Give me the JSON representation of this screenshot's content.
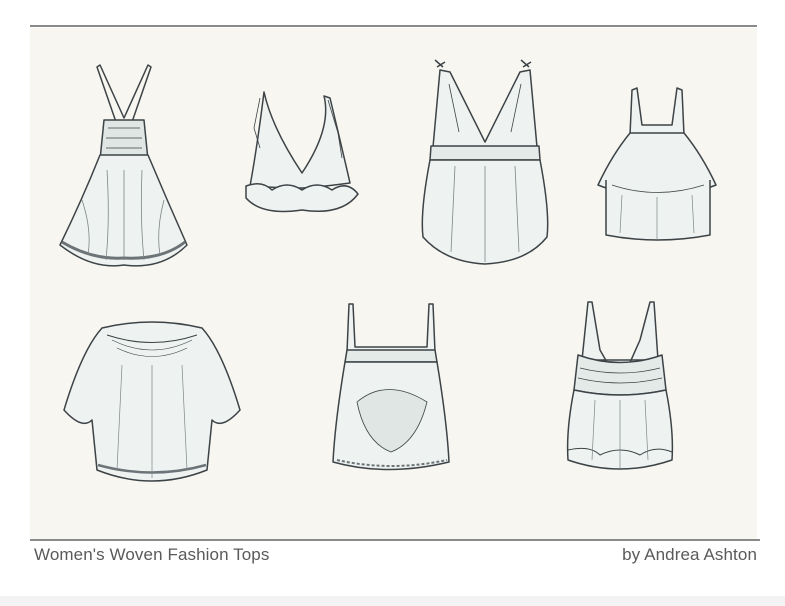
{
  "caption": {
    "title": "Women's Woven Fashion Tops",
    "author": "by Andrea Ashton"
  },
  "garments": [
    {
      "id": "crisscross-strap-babydoll-top",
      "icon": "babydoll-top-sketch"
    },
    {
      "id": "ruffle-trim-bralette",
      "icon": "bralette-sketch"
    },
    {
      "id": "tie-shoulder-empire-top",
      "icon": "empire-top-sketch"
    },
    {
      "id": "tiered-ruffle-top",
      "icon": "tiered-top-sketch"
    },
    {
      "id": "peasant-kimono-sleeve-top",
      "icon": "peasant-top-sketch"
    },
    {
      "id": "hi-lo-eyelet-cami",
      "icon": "eyelet-cami-sketch"
    },
    {
      "id": "smocked-v-neck-cami",
      "icon": "vneck-cami-sketch"
    }
  ],
  "colors": {
    "background": "#f7f6f1",
    "rule": "#8a8a8a",
    "caption_text": "#5a5a5a",
    "garment_fill": "#eef3f1",
    "garment_line": "#3d4346"
  }
}
